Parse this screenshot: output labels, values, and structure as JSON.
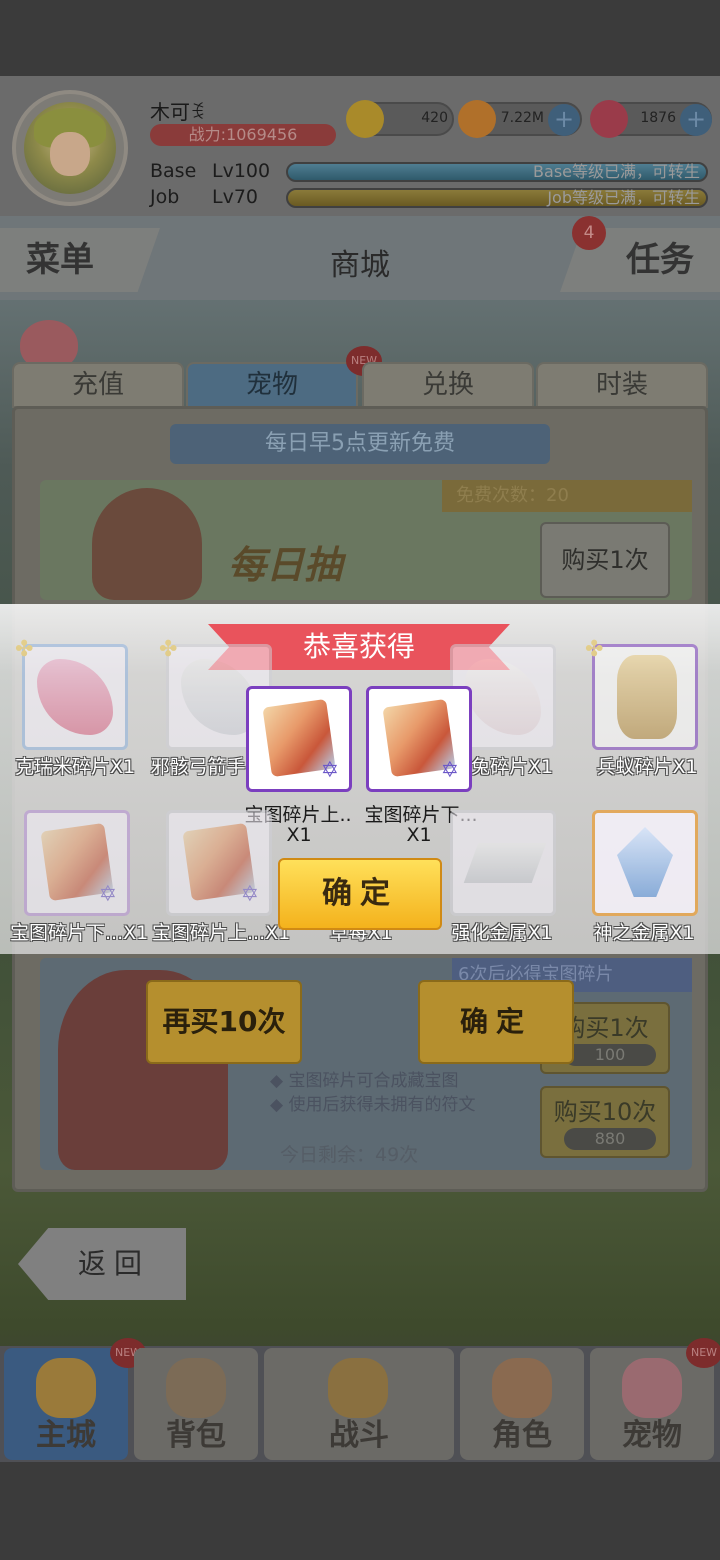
{
  "player": {
    "name": "木可",
    "name_tag": "ꉂ",
    "power": "战力:1069456",
    "base_label": "Base",
    "base_level": "Lv100",
    "base_status": "Base等级已满，可转生",
    "job_label": "Job",
    "job_level": "Lv70",
    "job_status": "Job等级已满，可转生"
  },
  "currencies": [
    {
      "icon": "zeny-coin-icon",
      "value": "420"
    },
    {
      "icon": "gold-coin-icon",
      "value": "7.22M"
    },
    {
      "icon": "red-gem-icon",
      "value": "1876"
    }
  ],
  "nav": {
    "menu": "菜单",
    "title": "商城",
    "task": "任务",
    "task_badge": "4"
  },
  "tabs": [
    {
      "label": "充值",
      "active": false
    },
    {
      "label": "宠物",
      "active": true,
      "badge": "NEW"
    },
    {
      "label": "兑换",
      "active": false
    },
    {
      "label": "时装",
      "active": false
    }
  ],
  "shop": {
    "daily_note": "每日早5点更新免费",
    "free_count": "免费次数：20",
    "banner_title": "每日抽",
    "buy_once": "购买1次",
    "guarantee": "6次后必得宝图碎片",
    "bullet1": "宝图碎片可合成藏宝图",
    "bullet2": "使用后获得未拥有的符文",
    "remaining": "今日剩余：49次",
    "buy_once_cost": "100",
    "buy_ten": "购买10次",
    "buy_ten_cost": "880",
    "back": "返回"
  },
  "modal": {
    "title": "恭喜获得",
    "featured": [
      {
        "label": "宝图碎片上..",
        "qty": "X1"
      },
      {
        "label": "宝图碎片下...",
        "qty": "X1"
      }
    ],
    "row1": [
      {
        "label": "克瑞米碎片X1"
      },
      {
        "label": "邪骸弓箭手"
      },
      {
        "label": "兔碎片X1"
      },
      {
        "label": "兵蚁碎片X1"
      }
    ],
    "row2": [
      {
        "label": "宝图碎片下...X1"
      },
      {
        "label": "宝图碎片上...X1"
      },
      {
        "label": "草莓X1"
      },
      {
        "label": "强化金属X1"
      },
      {
        "label": "神之金属X1"
      }
    ],
    "confirm": "确定",
    "buy_again": "再买10次",
    "confirm2": "确定"
  },
  "bottom_nav": [
    {
      "label": "主城",
      "active": true,
      "badge": "NEW"
    },
    {
      "label": "背包",
      "active": false
    },
    {
      "label": "战斗",
      "active": false
    },
    {
      "label": "角色",
      "active": false
    },
    {
      "label": "宠物",
      "active": false,
      "badge": "NEW"
    }
  ],
  "colors": {
    "ribbon": "#e9535c",
    "confirm_gold": "#f4b21c",
    "item_border_purple": "#7b3fbf"
  }
}
